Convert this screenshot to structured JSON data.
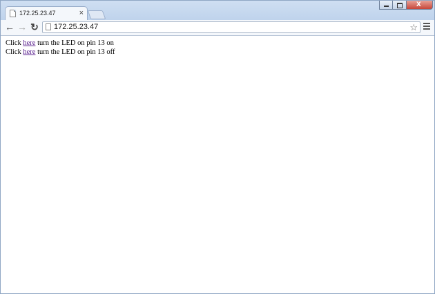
{
  "tab": {
    "title": "172.25.23.47",
    "close_label": "×"
  },
  "toolbar": {
    "back_label": "←",
    "forward_label": "→",
    "reload_label": "↻",
    "url": "172.25.23.47",
    "star_label": "☆"
  },
  "page": {
    "lines": [
      {
        "prefix": "Click ",
        "link": "here",
        "suffix": " turn the LED on pin 13 on"
      },
      {
        "prefix": "Click ",
        "link": "here",
        "suffix": " turn the LED on pin 13 off"
      }
    ]
  },
  "colors": {
    "visited_link": "#551a8b",
    "frame": "#d9e6f5",
    "close_button": "#c7463a"
  },
  "icons": [
    "page-icon",
    "close-icon",
    "back-icon",
    "forward-icon",
    "reload-icon",
    "star-icon",
    "menu-icon"
  ]
}
